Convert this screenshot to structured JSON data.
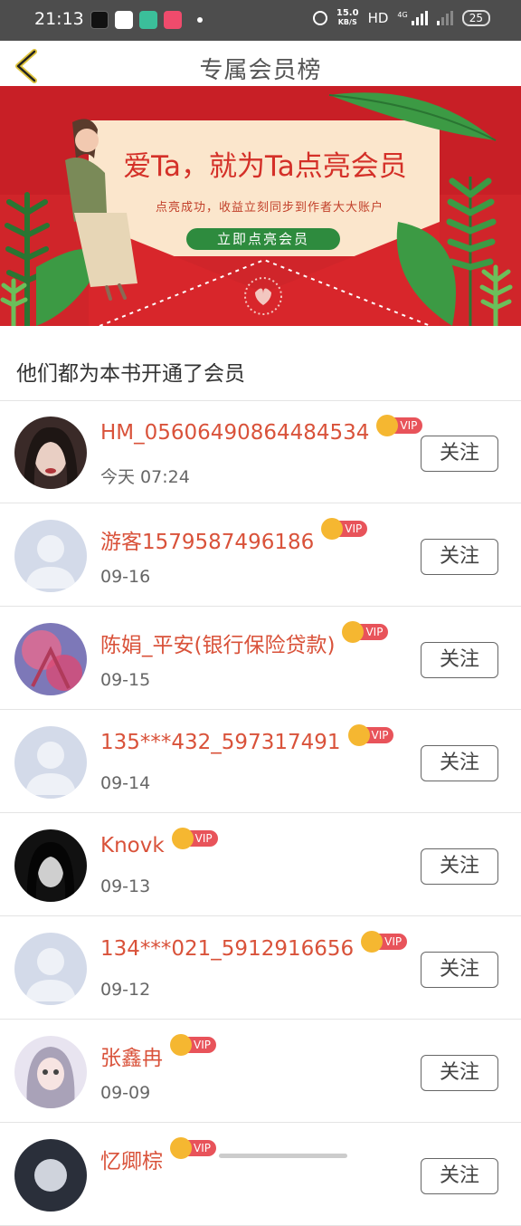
{
  "status_bar": {
    "time": "21:13",
    "speed_value": "15.0",
    "speed_unit": "KB/S",
    "hd": "HD",
    "network": "4G",
    "battery": "25"
  },
  "header": {
    "title": "专属会员榜"
  },
  "banner": {
    "headline": "爱Ta，就为Ta点亮会员",
    "subline": "点亮成功，收益立刻同步到作者大大账户",
    "button": "立即点亮会员"
  },
  "section_title": "他们都为本书开通了会员",
  "vip_label": "VIP",
  "follow_label": "关注",
  "members": [
    {
      "name": "HM_05606490864484534",
      "date": "今天 07:24",
      "avatar": "photo-dark-hair"
    },
    {
      "name": "游客1579587496186",
      "date": "09-16",
      "avatar": "default-person"
    },
    {
      "name": "陈娟_平安(银行保险贷款)",
      "date": "09-15",
      "avatar": "photo-pink-flowers"
    },
    {
      "name": "135***432_597317491",
      "date": "09-14",
      "avatar": "default-person"
    },
    {
      "name": "Knovk",
      "date": "09-13",
      "avatar": "photo-dark-portrait"
    },
    {
      "name": "134***021_5912916656",
      "date": "09-12",
      "avatar": "default-person"
    },
    {
      "name": "张鑫冉",
      "date": "09-09",
      "avatar": "photo-girl"
    },
    {
      "name": "忆卿棕",
      "date": "",
      "avatar": "photo-partial"
    }
  ],
  "colors": {
    "name": "#d9523a",
    "vip_badge": "#e8535a",
    "crown": "#f5b731",
    "banner_red": "#d0252a"
  }
}
